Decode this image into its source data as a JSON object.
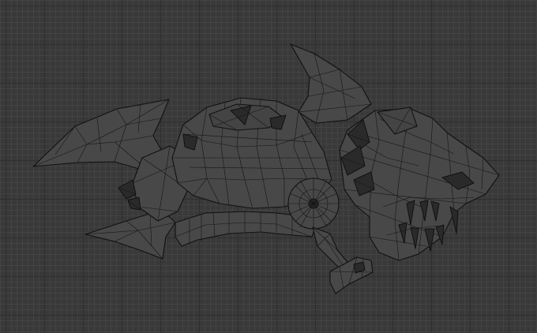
{
  "viewport": {
    "mode": "wireframe",
    "grid": true,
    "colors": {
      "background": "#393939",
      "grid_minor": "#434343",
      "grid_major": "#2f2f2f",
      "wire": "#111111",
      "face": "#484848"
    }
  },
  "model": {
    "icon": "wireframe-mesh"
  }
}
